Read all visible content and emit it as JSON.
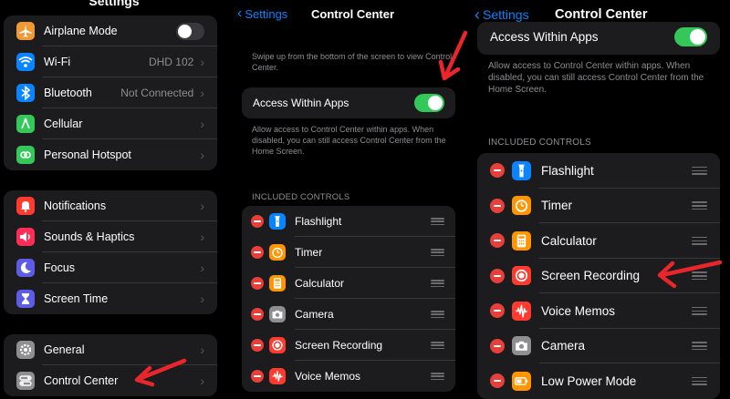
{
  "settings": {
    "title": "Settings",
    "group1": [
      {
        "label": "Airplane Mode",
        "icon": "airplane-icon",
        "color": "#f09a37",
        "toggle": false
      },
      {
        "label": "Wi-Fi",
        "icon": "wifi-icon",
        "color": "#0a84ff",
        "value": "DHD 102"
      },
      {
        "label": "Bluetooth",
        "icon": "bluetooth-icon",
        "color": "#0a84ff",
        "value": "Not Connected"
      },
      {
        "label": "Cellular",
        "icon": "cellular-icon",
        "color": "#34c759"
      },
      {
        "label": "Personal Hotspot",
        "icon": "hotspot-icon",
        "color": "#34c759"
      }
    ],
    "group2": [
      {
        "label": "Notifications",
        "icon": "bell-icon",
        "color": "#ff3b30"
      },
      {
        "label": "Sounds & Haptics",
        "icon": "speaker-icon",
        "color": "#ff2d55"
      },
      {
        "label": "Focus",
        "icon": "moon-icon",
        "color": "#5e5ce6"
      },
      {
        "label": "Screen Time",
        "icon": "hourglass-icon",
        "color": "#5e5ce6"
      }
    ],
    "group3": [
      {
        "label": "General",
        "icon": "gear-icon",
        "color": "#8e8e93"
      },
      {
        "label": "Control Center",
        "icon": "switches-icon",
        "color": "#8e8e93"
      }
    ]
  },
  "cc_middle": {
    "back": "Settings",
    "title": "Control Center",
    "intro": "Swipe up from the bottom of the screen to view Control Center.",
    "access_label": "Access Within Apps",
    "access_on": true,
    "access_note": "Allow access to Control Center within apps. When disabled, you can still access Control Center from the Home Screen.",
    "section": "INCLUDED CONTROLS",
    "controls": [
      {
        "label": "Flashlight",
        "icon": "flashlight-icon",
        "color": "#0a84ff"
      },
      {
        "label": "Timer",
        "icon": "timer-icon",
        "color": "#ff9500"
      },
      {
        "label": "Calculator",
        "icon": "calculator-icon",
        "color": "#ff9500"
      },
      {
        "label": "Camera",
        "icon": "camera-icon",
        "color": "#8e8e93"
      },
      {
        "label": "Screen Recording",
        "icon": "record-icon",
        "color": "#ff3b30"
      },
      {
        "label": "Voice Memos",
        "icon": "waveform-icon",
        "color": "#ff3b30"
      }
    ]
  },
  "cc_right": {
    "back": "Settings",
    "title": "Control Center",
    "access_label": "Access Within Apps",
    "access_on": true,
    "access_note": "Allow access to Control Center within apps. When disabled, you can still access Control Center from the Home Screen.",
    "section": "INCLUDED CONTROLS",
    "controls": [
      {
        "label": "Flashlight",
        "icon": "flashlight-icon",
        "color": "#0a84ff"
      },
      {
        "label": "Timer",
        "icon": "timer-icon",
        "color": "#ff9500"
      },
      {
        "label": "Calculator",
        "icon": "calculator-icon",
        "color": "#ff9500"
      },
      {
        "label": "Screen Recording",
        "icon": "record-icon",
        "color": "#ff3b30"
      },
      {
        "label": "Voice Memos",
        "icon": "waveform-icon",
        "color": "#ff3b30"
      },
      {
        "label": "Camera",
        "icon": "camera-icon",
        "color": "#8e8e93"
      },
      {
        "label": "Low Power Mode",
        "icon": "battery-icon",
        "color": "#ff9500"
      }
    ]
  },
  "colors": {
    "toggle_on": "#34c759",
    "toggle_off": "#39393d",
    "arrow": "#e8262b",
    "accent": "#0a84ff"
  }
}
